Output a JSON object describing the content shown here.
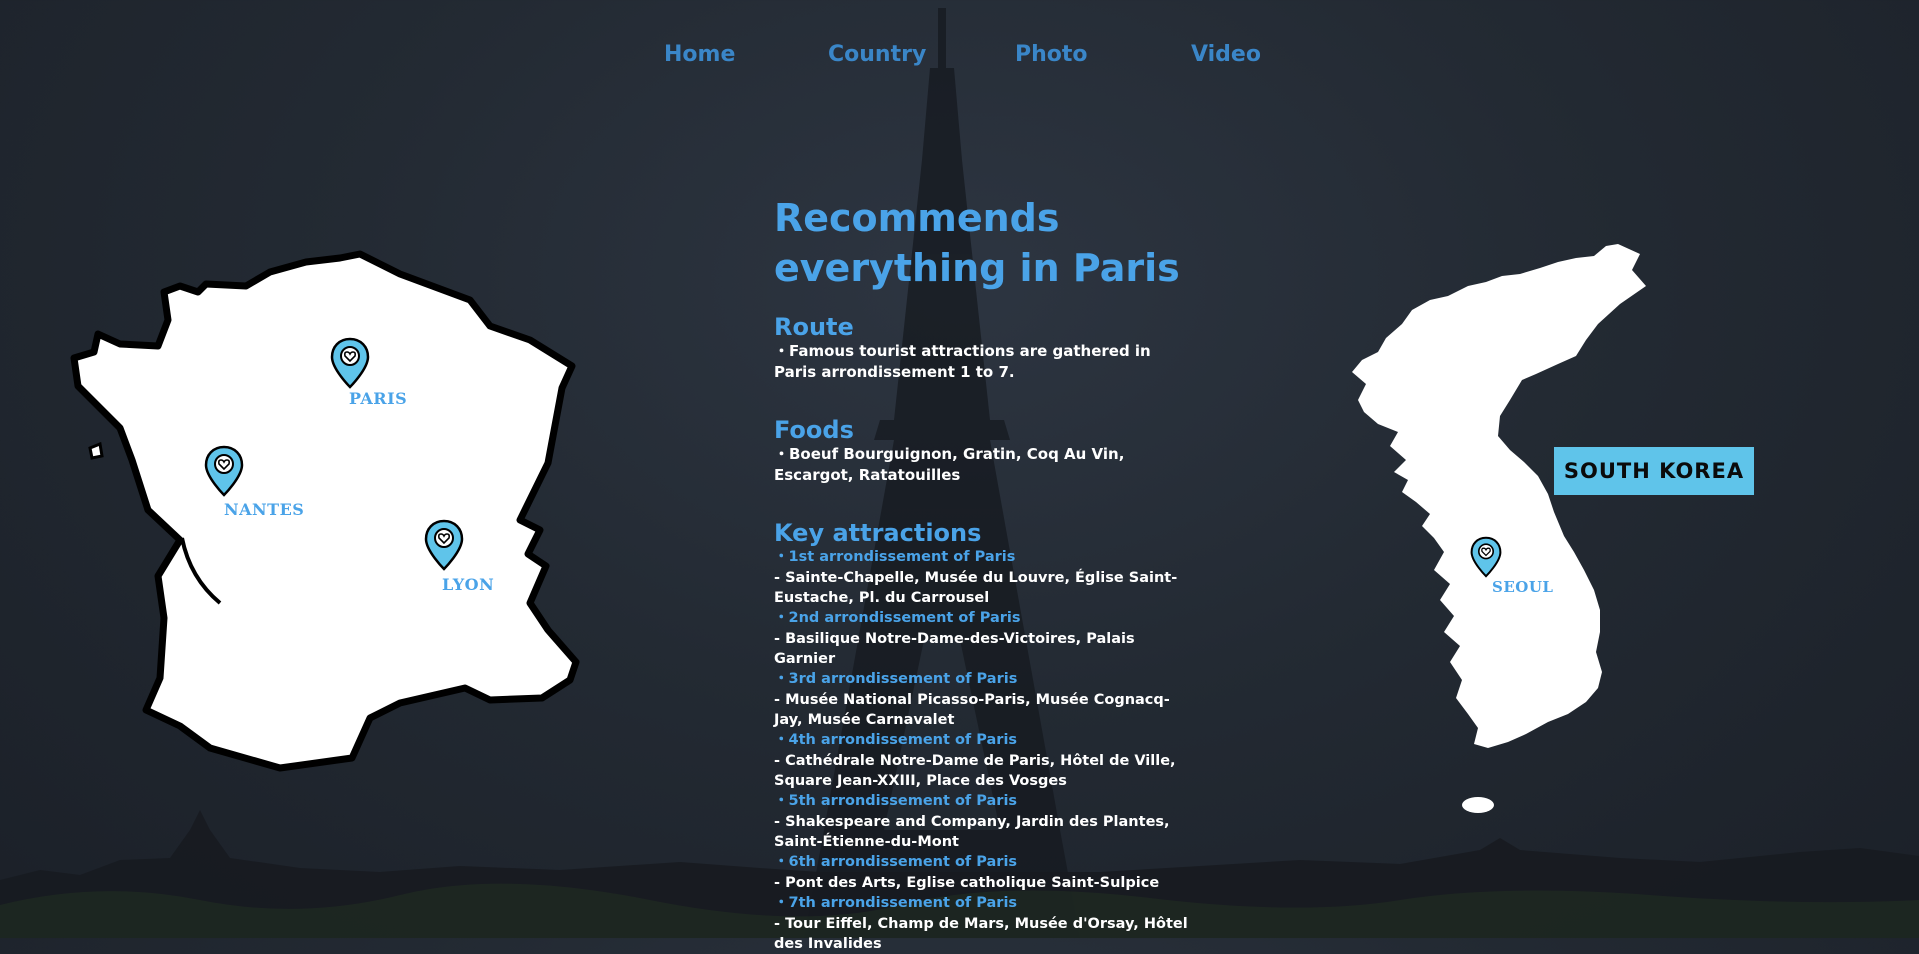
{
  "nav": {
    "home": "Home",
    "country": "Country",
    "photo": "Photo",
    "video": "Video"
  },
  "main": {
    "title_line1": "Recommends",
    "title_line2": "everything in Paris",
    "route": {
      "heading": "Route",
      "text": "・Famous tourist attractions are gathered in Paris arrondissement 1 to 7."
    },
    "foods": {
      "heading": "Foods",
      "text": "・Boeuf Bourguignon, Gratin, Coq Au Vin, Escargot, Ratatouilles"
    },
    "key_attractions": {
      "heading": "Key attractions",
      "items": [
        {
          "label": "・1st arrondissement of Paris",
          "places": "  - Sainte-Chapelle, Musée du Louvre, Église Saint-Eustache, Pl. du Carrousel"
        },
        {
          "label": "・2nd arrondissement of Paris",
          "places": "  - Basilique Notre-Dame-des-Victoires, Palais Garnier"
        },
        {
          "label": "・3rd arrondissement of Paris",
          "places": "  - Musée National Picasso-Paris, Musée Cognacq-Jay, Musée Carnavalet"
        },
        {
          "label": "・4th arrondissement of Paris",
          "places": "  - Cathédrale Notre-Dame de Paris, Hôtel de Ville, Square Jean-XXIII, Place des Vosges"
        },
        {
          "label": "・5th arrondissement of Paris",
          "places": "  - Shakespeare and Company, Jardin des Plantes, Saint-Étienne-du-Mont"
        },
        {
          "label": "・6th arrondissement of Paris",
          "places": "  - Pont des Arts, Eglise catholique Saint-Sulpice"
        },
        {
          "label": "・7th arrondissement of Paris",
          "places": "  - Tour Eiffel, Champ de Mars, Musée d'Orsay, Hôtel des Invalides"
        }
      ]
    }
  },
  "france_map": {
    "cities": [
      "PARIS",
      "NANTES",
      "LYON"
    ]
  },
  "korea_map": {
    "badge": "SOUTH KOREA",
    "city": "SEOUL"
  },
  "colors": {
    "accent": "#4aa3e8",
    "pin": "#5fc4ea",
    "background": "#232a33"
  }
}
